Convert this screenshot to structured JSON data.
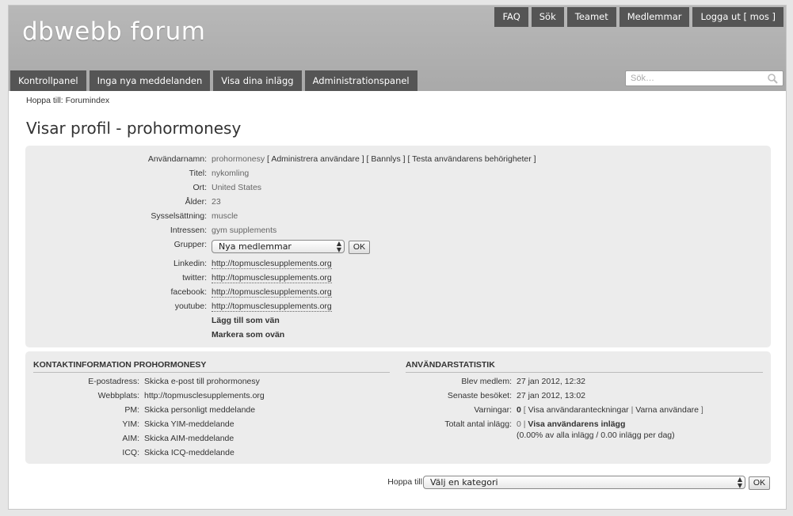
{
  "site": {
    "title": "dbwebb forum"
  },
  "topnav": [
    {
      "name": "topnav-faq",
      "label": "FAQ"
    },
    {
      "name": "topnav-search",
      "label": "Sök"
    },
    {
      "name": "topnav-team",
      "label": "Teamet"
    },
    {
      "name": "topnav-members",
      "label": "Medlemmar"
    },
    {
      "name": "topnav-logout",
      "label": "Logga ut [ mos ]"
    }
  ],
  "mainnav": [
    {
      "name": "nav-control-panel",
      "label": "Kontrollpanel"
    },
    {
      "name": "nav-no-new-posts",
      "label": "Inga nya meddelanden"
    },
    {
      "name": "nav-your-posts",
      "label": "Visa dina inlägg"
    },
    {
      "name": "nav-admin-panel",
      "label": "Administrationspanel"
    }
  ],
  "search": {
    "placeholder": "Sök…"
  },
  "breadcrumb": {
    "prefix": "Hoppa till:",
    "link": "Forumindex"
  },
  "page": {
    "title": "Visar profil - prohormonesy"
  },
  "profile": {
    "username_label": "Användarnamn:",
    "username": "prohormonesy",
    "admin_links": [
      "Administrera användare",
      "Bannlys",
      "Testa användarens behörigheter"
    ],
    "title_label": "Titel:",
    "title": "nykomling",
    "location_label": "Ort:",
    "location": "United States",
    "age_label": "Ålder:",
    "age": "23",
    "occupation_label": "Sysselsättning:",
    "occupation": "muscle",
    "interests_label": "Intressen:",
    "interests": "gym supplements",
    "groups_label": "Grupper:",
    "groups_selected": "Nya medlemmar",
    "groups_ok": "OK",
    "linkedin_label": "Linkedin:",
    "linkedin": "http://topmusclesupplements.org",
    "twitter_label": "twitter:",
    "twitter": "http://topmusclesupplements.org",
    "facebook_label": "facebook:",
    "facebook": "http://topmusclesupplements.org",
    "youtube_label": "youtube:",
    "youtube": "http://topmusclesupplements.org",
    "add_friend": "Lägg till som vän",
    "add_foe": "Markera som ovän"
  },
  "contact": {
    "heading": "KONTAKTINFORMATION PROHORMONESY",
    "rows": [
      {
        "label": "E-postadress:",
        "value": "Skicka e-post till prohormonesy"
      },
      {
        "label": "Webbplats:",
        "value": "http://topmusclesupplements.org"
      },
      {
        "label": "PM:",
        "value": "Skicka personligt meddelande"
      },
      {
        "label": "YIM:",
        "value": "Skicka YIM-meddelande"
      },
      {
        "label": "AIM:",
        "value": "Skicka AIM-meddelande"
      },
      {
        "label": "ICQ:",
        "value": "Skicka ICQ-meddelande"
      }
    ]
  },
  "stats": {
    "heading": "ANVÄNDARSTATISTIK",
    "joined_label": "Blev medlem:",
    "joined": "27 jan 2012, 12:32",
    "lastvisit_label": "Senaste besöket:",
    "lastvisit": "27 jan 2012, 13:02",
    "warnings_label": "Varningar:",
    "warnings_count": "0",
    "warnings_links": [
      "Visa användaranteckningar",
      "Varna användare"
    ],
    "posts_label": "Totalt antal inlägg:",
    "posts_count": "0",
    "posts_link": "Visa användarens inlägg",
    "posts_detail": "(0.00% av alla inlägg / 0.00 inlägg per dag)"
  },
  "jumpbox": {
    "label": "Hoppa till:",
    "selected": "Välj en kategori",
    "ok": "OK"
  }
}
